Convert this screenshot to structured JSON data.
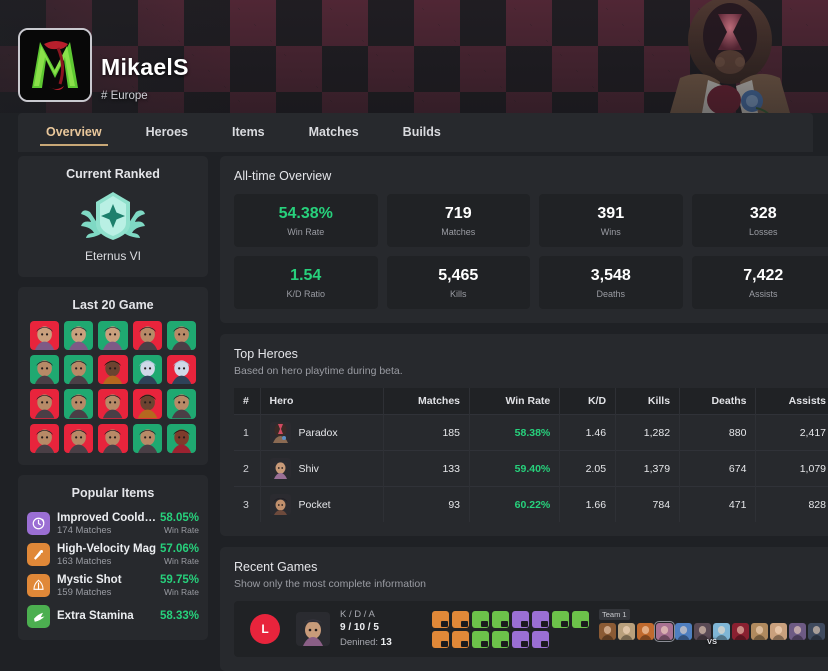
{
  "profile": {
    "name": "MikaelS",
    "region": "# Europe",
    "avatar_icon": "player-logo-m"
  },
  "tabs": [
    {
      "label": "Overview",
      "active": true
    },
    {
      "label": "Heroes",
      "active": false
    },
    {
      "label": "Items",
      "active": false
    },
    {
      "label": "Matches",
      "active": false
    },
    {
      "label": "Builds",
      "active": false
    }
  ],
  "current_ranked": {
    "title": "Current Ranked",
    "rank_name": "Eternus VI",
    "badge_icon": "rank-shield-star-icon",
    "badge_color": "#7fd9c4"
  },
  "last_20": {
    "title": "Last 20 Game",
    "win_color": "#1fa971",
    "loss_color": "#e8243c",
    "results": [
      "loss",
      "win",
      "win",
      "loss",
      "win",
      "win",
      "win",
      "loss",
      "win",
      "loss",
      "loss",
      "win",
      "loss",
      "loss",
      "win",
      "loss",
      "loss",
      "loss",
      "win",
      "win"
    ]
  },
  "popular_items": {
    "title": "Popular Items",
    "win_rate_label": "Win Rate",
    "items": [
      {
        "name": "Improved Cooldown",
        "matches": "174 Matches",
        "win_rate": "58.05%",
        "color": "#9b6fd4",
        "icon": "cooldown-icon"
      },
      {
        "name": "High-Velocity Mag",
        "matches": "163 Matches",
        "win_rate": "57.06%",
        "color": "#e08838",
        "icon": "mag-icon"
      },
      {
        "name": "Mystic Shot",
        "matches": "159 Matches",
        "win_rate": "59.75%",
        "color": "#e08838",
        "icon": "mystic-shot-icon"
      },
      {
        "name": "Extra Stamina",
        "matches": "",
        "win_rate": "58.33%",
        "color": "#4caf50",
        "icon": "stamina-icon"
      }
    ]
  },
  "all_time": {
    "title": "All-time Overview",
    "stats": [
      {
        "value": "54.38%",
        "label": "Win Rate",
        "green": true
      },
      {
        "value": "719",
        "label": "Matches",
        "green": false
      },
      {
        "value": "391",
        "label": "Wins",
        "green": false
      },
      {
        "value": "328",
        "label": "Losses",
        "green": false
      },
      {
        "value": "1.54",
        "label": "K/D Ratio",
        "green": true
      },
      {
        "value": "5,465",
        "label": "Kills",
        "green": false
      },
      {
        "value": "3,548",
        "label": "Deaths",
        "green": false
      },
      {
        "value": "7,422",
        "label": "Assists",
        "green": false
      }
    ]
  },
  "top_heroes": {
    "title": "Top Heroes",
    "subtitle": "Based on hero playtime during beta.",
    "columns": [
      "#",
      "Hero",
      "Matches",
      "Win Rate",
      "K/D",
      "Kills",
      "Deaths",
      "Assists"
    ],
    "rows": [
      {
        "rank": "1",
        "hero": "Paradox",
        "matches": "185",
        "win_rate": "58.38%",
        "kd": "1.46",
        "kills": "1,282",
        "deaths": "880",
        "assists": "2,417"
      },
      {
        "rank": "2",
        "hero": "Shiv",
        "matches": "133",
        "win_rate": "59.40%",
        "kd": "2.05",
        "kills": "1,379",
        "deaths": "674",
        "assists": "1,079"
      },
      {
        "rank": "3",
        "hero": "Pocket",
        "matches": "93",
        "win_rate": "60.22%",
        "kd": "1.66",
        "kills": "784",
        "deaths": "471",
        "assists": "828"
      }
    ]
  },
  "recent_games": {
    "title": "Recent Games",
    "subtitle": "Show only the most complete information",
    "match": {
      "result": "L",
      "kda_label": "K / D / A",
      "kda_value": "9 / 10 / 5",
      "denied_label": "Denined:",
      "denied_value": "13",
      "items_row1": [
        "w",
        "w",
        "v",
        "v",
        "s",
        "s",
        "v",
        "v"
      ],
      "items_row2": [
        "w",
        "w",
        "v",
        "v",
        "s",
        "s",
        "empty",
        "empty"
      ],
      "team_label": "Team 1",
      "vs_label": "VS"
    }
  },
  "colors": {
    "page_bg": "#1f2125",
    "panel_bg": "#27292d",
    "card_bg": "#202225",
    "accent_gold": "#e9c79b",
    "green": "#27d17c"
  }
}
